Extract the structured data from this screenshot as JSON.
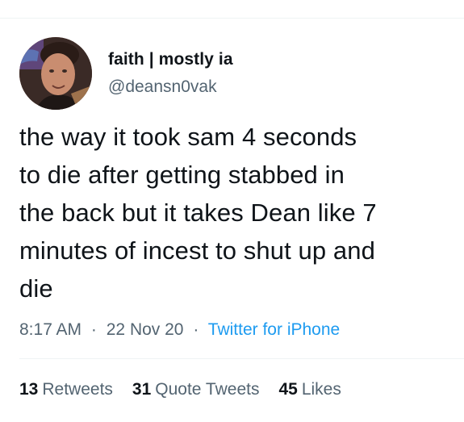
{
  "author": {
    "display_name": "faith | mostly ia",
    "handle": "@deansn0vak",
    "avatar": "avatar-photo"
  },
  "tweet": {
    "text": "the way it took sam 4 seconds\nto die after getting stabbed in\nthe back but it takes Dean like 7\nminutes of incest to shut up and\ndie",
    "time": "8:17 AM",
    "separator": "·",
    "date": "22 Nov 20",
    "source": "Twitter for iPhone"
  },
  "stats": {
    "retweets_count": "13",
    "retweets_label": "Retweets",
    "quote_count": "31",
    "quote_label": "Quote Tweets",
    "likes_count": "45",
    "likes_label": "Likes"
  },
  "colors": {
    "text_primary": "#0f1419",
    "text_secondary": "#536471",
    "link": "#1d9bf0",
    "divider": "#eff3f4"
  }
}
